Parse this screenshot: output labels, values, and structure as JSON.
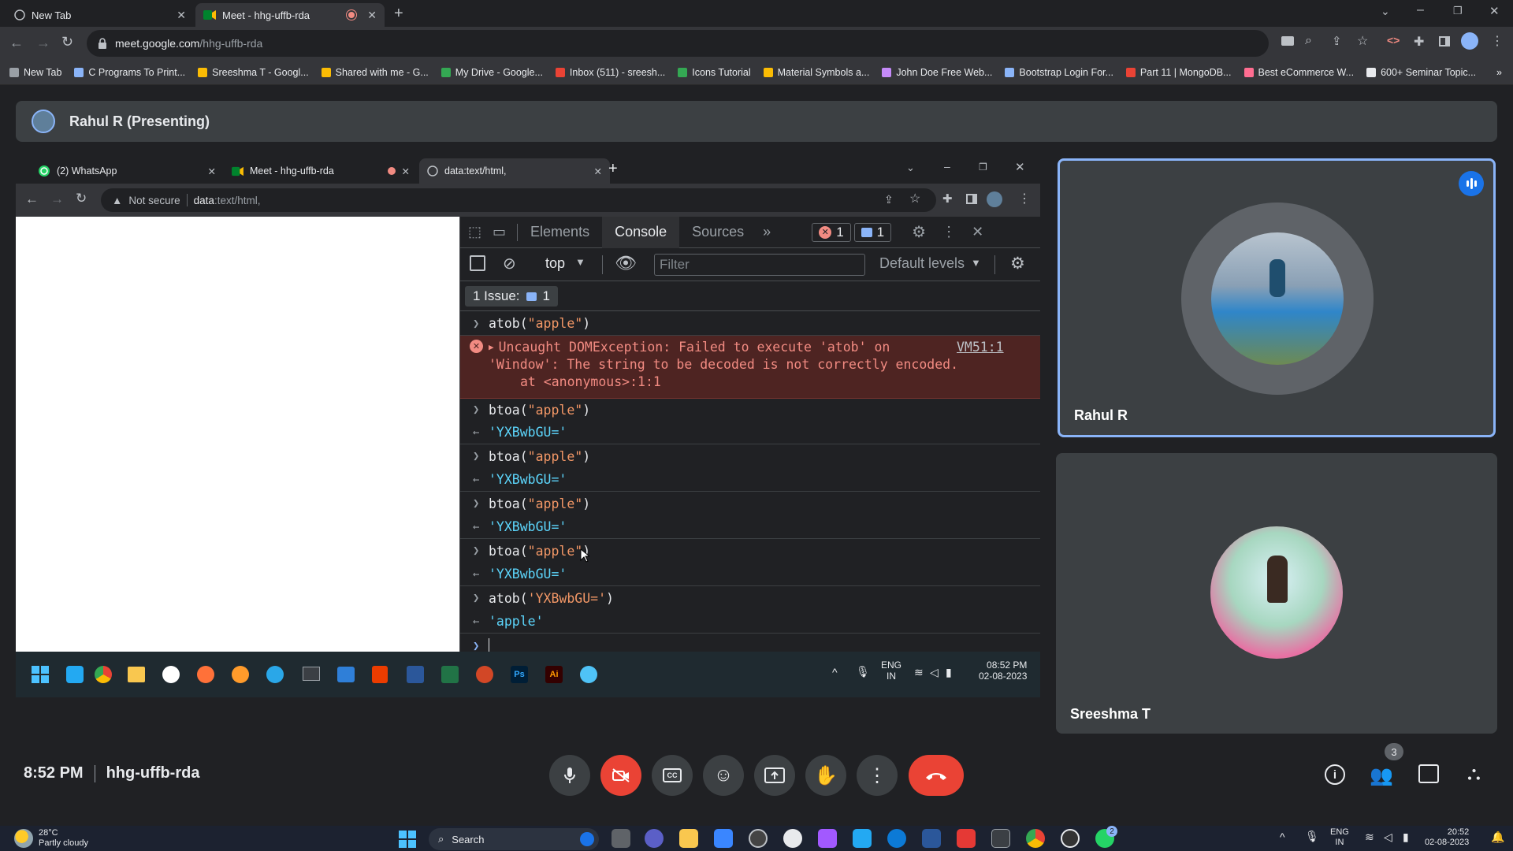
{
  "browser": {
    "tabs": [
      {
        "label": "New Tab"
      },
      {
        "label": "Meet - hhg-uffb-rda"
      }
    ],
    "url_host": "meet.google.com",
    "url_path": "/hhg-uffb-rda",
    "bookmarks": [
      {
        "label": "New Tab",
        "color": "#9aa0a6"
      },
      {
        "label": "C Programs To Print...",
        "color": "#8ab4f8"
      },
      {
        "label": "Sreeshma T - Googl...",
        "color": "#fbbc04"
      },
      {
        "label": "Shared with me - G...",
        "color": "#fbbc04"
      },
      {
        "label": "My Drive - Google...",
        "color": "#34a853"
      },
      {
        "label": "Inbox (511) - sreesh...",
        "color": "#ea4335"
      },
      {
        "label": "Icons Tutorial",
        "color": "#34a853"
      },
      {
        "label": "Material Symbols a...",
        "color": "#fbbc04"
      },
      {
        "label": "John Doe Free Web...",
        "color": "#c58af9"
      },
      {
        "label": "Bootstrap Login For...",
        "color": "#8ab4f8"
      },
      {
        "label": "Part 11 | MongoDB...",
        "color": "#ea4335"
      },
      {
        "label": "Best eCommerce W...",
        "color": "#ff6d91"
      },
      {
        "label": "600+ Seminar Topic...",
        "color": "#e8eaed"
      }
    ]
  },
  "meet": {
    "presenter_label": "Rahul R (Presenting)",
    "time": "8:52 PM",
    "meeting_code": "hhg-uffb-rda",
    "participant_count": "3",
    "participants": [
      {
        "name": "Rahul R"
      },
      {
        "name": "Sreeshma T"
      }
    ]
  },
  "shared": {
    "tabs": [
      {
        "label": "(2) WhatsApp"
      },
      {
        "label": "Meet - hhg-uffb-rda"
      },
      {
        "label": "data:text/html,"
      }
    ],
    "not_secure": "Not secure",
    "url_scheme": "data",
    "url_rest": ":text/html,",
    "devtools": {
      "tabs": [
        "Elements",
        "Console",
        "Sources"
      ],
      "error_count": "1",
      "message_count": "1",
      "context": "top",
      "filter_placeholder": "Filter",
      "levels": "Default levels",
      "issues_label": "1 Issue:",
      "issues_count": "1",
      "console": {
        "cmd1_fn": "atob(",
        "cmd1_arg": "\"apple\"",
        "error_line1": "Uncaught DOMException: Failed to execute 'atob' on",
        "error_line2": "'Window': The string to be decoded is not correctly encoded.",
        "error_line3": "at <anonymous>:1:1",
        "error_source": "VM51:1",
        "btoa_fn": "btoa(",
        "btoa_arg": "\"apple\"",
        "btoa_result": "'YXBwbGU='",
        "cmd6_fn": "atob(",
        "cmd6_arg": "'YXBwbGU='",
        "cmd6_result": "'apple'"
      }
    },
    "taskbar": {
      "lang1": "ENG",
      "lang2": "IN",
      "time": "08:52 PM",
      "date": "02-08-2023"
    }
  },
  "os_taskbar": {
    "temperature": "28°C",
    "weather": "Partly cloudy",
    "search_label": "Search",
    "lang1": "ENG",
    "lang2": "IN",
    "time": "20:52",
    "date": "02-08-2023",
    "whatsapp_badge": "2"
  }
}
